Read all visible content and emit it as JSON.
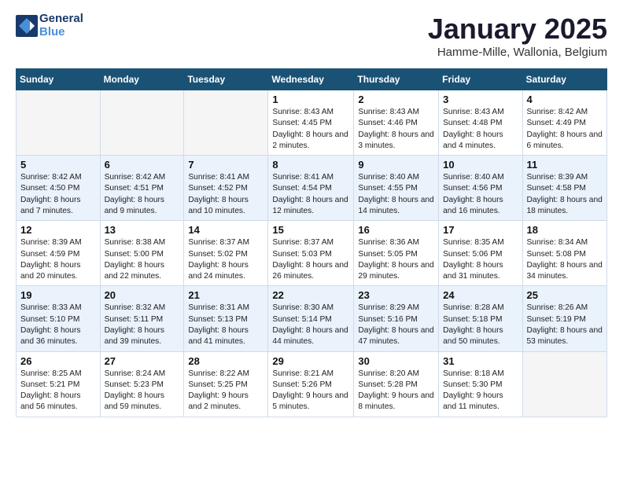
{
  "logo": {
    "line1": "General",
    "line2": "Blue"
  },
  "title": "January 2025",
  "subtitle": "Hamme-Mille, Wallonia, Belgium",
  "weekdays": [
    "Sunday",
    "Monday",
    "Tuesday",
    "Wednesday",
    "Thursday",
    "Friday",
    "Saturday"
  ],
  "weeks": [
    [
      {
        "day": "",
        "info": ""
      },
      {
        "day": "",
        "info": ""
      },
      {
        "day": "",
        "info": ""
      },
      {
        "day": "1",
        "info": "Sunrise: 8:43 AM\nSunset: 4:45 PM\nDaylight: 8 hours\nand 2 minutes."
      },
      {
        "day": "2",
        "info": "Sunrise: 8:43 AM\nSunset: 4:46 PM\nDaylight: 8 hours\nand 3 minutes."
      },
      {
        "day": "3",
        "info": "Sunrise: 8:43 AM\nSunset: 4:48 PM\nDaylight: 8 hours\nand 4 minutes."
      },
      {
        "day": "4",
        "info": "Sunrise: 8:42 AM\nSunset: 4:49 PM\nDaylight: 8 hours\nand 6 minutes."
      }
    ],
    [
      {
        "day": "5",
        "info": "Sunrise: 8:42 AM\nSunset: 4:50 PM\nDaylight: 8 hours\nand 7 minutes."
      },
      {
        "day": "6",
        "info": "Sunrise: 8:42 AM\nSunset: 4:51 PM\nDaylight: 8 hours\nand 9 minutes."
      },
      {
        "day": "7",
        "info": "Sunrise: 8:41 AM\nSunset: 4:52 PM\nDaylight: 8 hours\nand 10 minutes."
      },
      {
        "day": "8",
        "info": "Sunrise: 8:41 AM\nSunset: 4:54 PM\nDaylight: 8 hours\nand 12 minutes."
      },
      {
        "day": "9",
        "info": "Sunrise: 8:40 AM\nSunset: 4:55 PM\nDaylight: 8 hours\nand 14 minutes."
      },
      {
        "day": "10",
        "info": "Sunrise: 8:40 AM\nSunset: 4:56 PM\nDaylight: 8 hours\nand 16 minutes."
      },
      {
        "day": "11",
        "info": "Sunrise: 8:39 AM\nSunset: 4:58 PM\nDaylight: 8 hours\nand 18 minutes."
      }
    ],
    [
      {
        "day": "12",
        "info": "Sunrise: 8:39 AM\nSunset: 4:59 PM\nDaylight: 8 hours\nand 20 minutes."
      },
      {
        "day": "13",
        "info": "Sunrise: 8:38 AM\nSunset: 5:00 PM\nDaylight: 8 hours\nand 22 minutes."
      },
      {
        "day": "14",
        "info": "Sunrise: 8:37 AM\nSunset: 5:02 PM\nDaylight: 8 hours\nand 24 minutes."
      },
      {
        "day": "15",
        "info": "Sunrise: 8:37 AM\nSunset: 5:03 PM\nDaylight: 8 hours\nand 26 minutes."
      },
      {
        "day": "16",
        "info": "Sunrise: 8:36 AM\nSunset: 5:05 PM\nDaylight: 8 hours\nand 29 minutes."
      },
      {
        "day": "17",
        "info": "Sunrise: 8:35 AM\nSunset: 5:06 PM\nDaylight: 8 hours\nand 31 minutes."
      },
      {
        "day": "18",
        "info": "Sunrise: 8:34 AM\nSunset: 5:08 PM\nDaylight: 8 hours\nand 34 minutes."
      }
    ],
    [
      {
        "day": "19",
        "info": "Sunrise: 8:33 AM\nSunset: 5:10 PM\nDaylight: 8 hours\nand 36 minutes."
      },
      {
        "day": "20",
        "info": "Sunrise: 8:32 AM\nSunset: 5:11 PM\nDaylight: 8 hours\nand 39 minutes."
      },
      {
        "day": "21",
        "info": "Sunrise: 8:31 AM\nSunset: 5:13 PM\nDaylight: 8 hours\nand 41 minutes."
      },
      {
        "day": "22",
        "info": "Sunrise: 8:30 AM\nSunset: 5:14 PM\nDaylight: 8 hours\nand 44 minutes."
      },
      {
        "day": "23",
        "info": "Sunrise: 8:29 AM\nSunset: 5:16 PM\nDaylight: 8 hours\nand 47 minutes."
      },
      {
        "day": "24",
        "info": "Sunrise: 8:28 AM\nSunset: 5:18 PM\nDaylight: 8 hours\nand 50 minutes."
      },
      {
        "day": "25",
        "info": "Sunrise: 8:26 AM\nSunset: 5:19 PM\nDaylight: 8 hours\nand 53 minutes."
      }
    ],
    [
      {
        "day": "26",
        "info": "Sunrise: 8:25 AM\nSunset: 5:21 PM\nDaylight: 8 hours\nand 56 minutes."
      },
      {
        "day": "27",
        "info": "Sunrise: 8:24 AM\nSunset: 5:23 PM\nDaylight: 8 hours\nand 59 minutes."
      },
      {
        "day": "28",
        "info": "Sunrise: 8:22 AM\nSunset: 5:25 PM\nDaylight: 9 hours\nand 2 minutes."
      },
      {
        "day": "29",
        "info": "Sunrise: 8:21 AM\nSunset: 5:26 PM\nDaylight: 9 hours\nand 5 minutes."
      },
      {
        "day": "30",
        "info": "Sunrise: 8:20 AM\nSunset: 5:28 PM\nDaylight: 9 hours\nand 8 minutes."
      },
      {
        "day": "31",
        "info": "Sunrise: 8:18 AM\nSunset: 5:30 PM\nDaylight: 9 hours\nand 11 minutes."
      },
      {
        "day": "",
        "info": ""
      }
    ]
  ]
}
